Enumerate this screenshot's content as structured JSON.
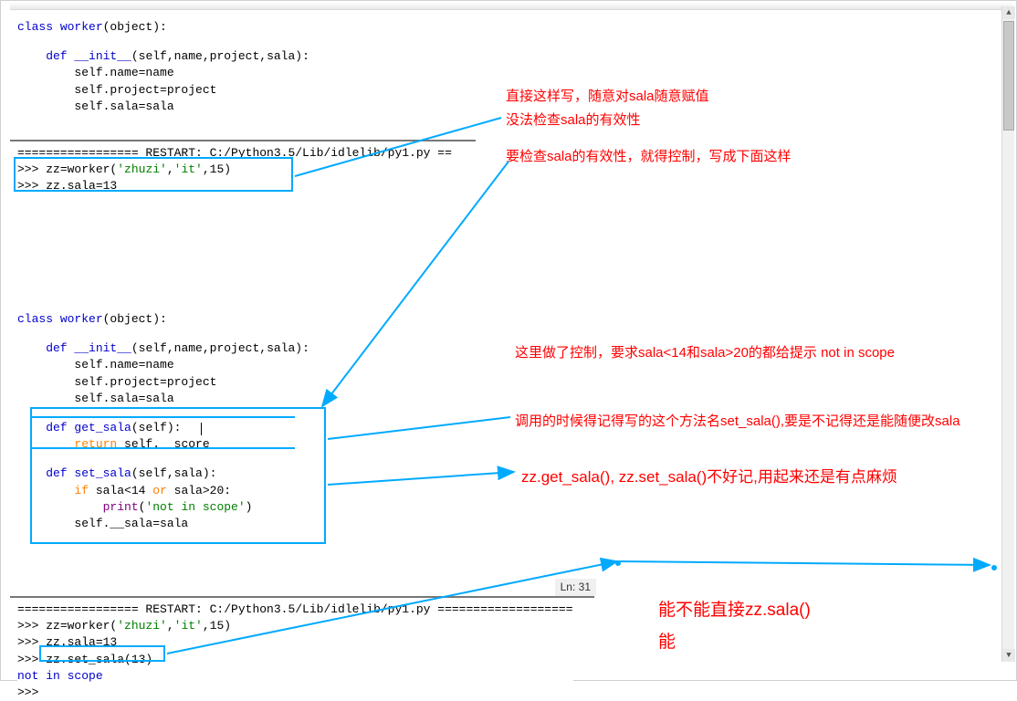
{
  "code1": {
    "l1a": "class ",
    "l1b": "worker",
    "l1c": "(object):",
    "l2a": "    def ",
    "l2b": "__init__",
    "l2c": "(self,name,project,sala):",
    "l3": "        self.name=name",
    "l4": "        self.project=project",
    "l5": "        self.sala=sala",
    "sep": "================= RESTART: C:/Python3.5/Lib/idlelib/py1.py ==",
    "p1": ">>> ",
    "p1b": "zz=worker(",
    "p1c": "'zhuzi'",
    "p1d": ",",
    "p1e": "'it'",
    "p1f": ",15)",
    "p2": ">>> ",
    "p2b": "zz.sala=13"
  },
  "code2": {
    "l1a": "class ",
    "l1b": "worker",
    "l1c": "(object):",
    "l2a": "    def ",
    "l2b": "__init__",
    "l2c": "(self,name,project,sala):",
    "l3": "        self.name=name",
    "l4": "        self.project=project",
    "l5": "        self.sala=sala",
    "l6a": "    def ",
    "l6b": "get_sala",
    "l6c": "(self):",
    "l7a": "        return ",
    "l7b": "self.__score",
    "l8a": "    def ",
    "l8b": "set_sala",
    "l8c": "(self,sala):",
    "l9a": "        if ",
    "l9b": "sala<14 ",
    "l9c": "or ",
    "l9d": "sala>20:",
    "l10a": "            print",
    "l10b": "(",
    "l10c": "'not in scope'",
    "l10d": ")",
    "l11": "        self.__sala=sala"
  },
  "code3": {
    "sep": "================= RESTART: C:/Python3.5/Lib/idlelib/py1.py ===================",
    "p1": ">>> ",
    "p1b": "zz=worker(",
    "p1c": "'zhuzi'",
    "p1d": ",",
    "p1e": "'it'",
    "p1f": ",15)",
    "p2": ">>> ",
    "p2b": "zz.sala=13",
    "p3": ">>> ",
    "p3b": "zz.set_sala(13)",
    "out": "not in scope",
    "p4": ">>> "
  },
  "annot": {
    "a1": "直接这样写，随意对sala随意赋值",
    "a2": "没法检查sala的有效性",
    "a3": "要检查sala的有效性，就得控制，写成下面这样",
    "a4": "这里做了控制，要求sala<14和sala>20的都给提示 not in scope",
    "a5": "调用的时候得记得写的这个方法名set_sala(),要是不记得还是能随便改sala",
    "a6": "zz.get_sala(), zz.set_sala()不好记,用起来还是有点麻烦",
    "a7": "能不能直接zz.sala()",
    "a8": "能"
  },
  "status": {
    "ln": "Ln: 31"
  }
}
